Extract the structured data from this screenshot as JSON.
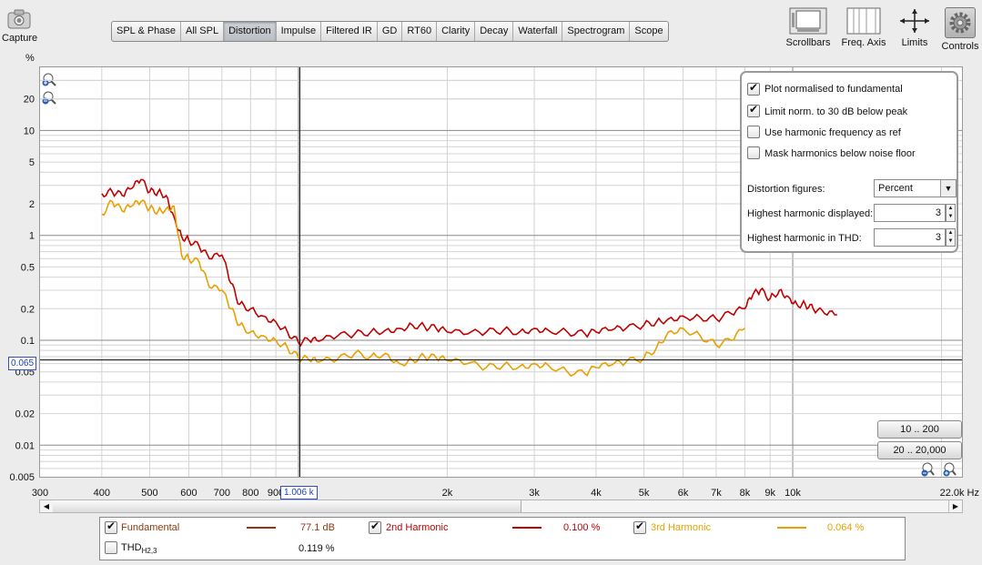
{
  "toolbar": {
    "capture_label": "Capture",
    "tabs": [
      "SPL & Phase",
      "All SPL",
      "Distortion",
      "Impulse",
      "Filtered IR",
      "GD",
      "RT60",
      "Clarity",
      "Decay",
      "Waterfall",
      "Spectrogram",
      "Scope"
    ],
    "active_tab": "Distortion",
    "right_buttons": [
      "Scrollbars",
      "Freq. Axis",
      "Limits",
      "Controls"
    ]
  },
  "plot": {
    "y_unit_label": "%",
    "cursor_y_readout": "0.065",
    "cursor_x_readout": "1.006 k"
  },
  "controls": {
    "checkboxes": [
      {
        "label": "Plot normalised to fundamental",
        "checked": true
      },
      {
        "label": "Limit norm. to 30 dB below peak",
        "checked": true
      },
      {
        "label": "Use harmonic frequency as ref",
        "checked": false
      },
      {
        "label": "Mask harmonics below noise floor",
        "checked": false
      }
    ],
    "distortion_figures_label": "Distortion figures:",
    "distortion_figures_value": "Percent",
    "highest_displayed_label": "Highest harmonic displayed:",
    "highest_displayed_value": "3",
    "highest_thd_label": "Highest harmonic in THD:",
    "highest_thd_value": "3"
  },
  "range_buttons": [
    "10 .. 200",
    "20 .. 20,000"
  ],
  "legend": {
    "fundamental": {
      "label": "Fundamental",
      "value": "77.1 dB",
      "checked": true,
      "color": "#8b3a0f"
    },
    "h2": {
      "label": "2nd Harmonic",
      "value": "0.100 %",
      "checked": true,
      "color": "#c00000"
    },
    "h3": {
      "label": "3rd Harmonic",
      "value": "0.064 %",
      "checked": true,
      "color": "#e8a000"
    },
    "thd": {
      "label": "THD",
      "sub": "H2,3",
      "value": "0.119 %",
      "checked": false
    }
  },
  "chart_data": {
    "type": "line",
    "xlabel": "Hz",
    "ylabel": "%",
    "x_scale": "log",
    "y_scale": "log",
    "xlim": [
      300,
      22000
    ],
    "ylim": [
      0.005,
      40
    ],
    "x_ticks": [
      {
        "v": 300,
        "l": "300"
      },
      {
        "v": 400,
        "l": "400"
      },
      {
        "v": 500,
        "l": "500"
      },
      {
        "v": 600,
        "l": "600"
      },
      {
        "v": 700,
        "l": "700"
      },
      {
        "v": 800,
        "l": "800"
      },
      {
        "v": 900,
        "l": "900"
      },
      {
        "v": 2000,
        "l": "2k"
      },
      {
        "v": 3000,
        "l": "3k"
      },
      {
        "v": 4000,
        "l": "4k"
      },
      {
        "v": 5000,
        "l": "5k"
      },
      {
        "v": 6000,
        "l": "6k"
      },
      {
        "v": 7000,
        "l": "7k"
      },
      {
        "v": 8000,
        "l": "8k"
      },
      {
        "v": 9000,
        "l": "9k"
      },
      {
        "v": 10000,
        "l": "10k"
      },
      {
        "v": 22000,
        "l": "22.0k Hz"
      }
    ],
    "y_ticks": [
      {
        "v": 20,
        "l": "20"
      },
      {
        "v": 10,
        "l": "10"
      },
      {
        "v": 5,
        "l": "5"
      },
      {
        "v": 2,
        "l": "2"
      },
      {
        "v": 1,
        "l": "1"
      },
      {
        "v": 0.5,
        "l": "0.5"
      },
      {
        "v": 0.2,
        "l": "0.2"
      },
      {
        "v": 0.1,
        "l": "0.1"
      },
      {
        "v": 0.05,
        "l": "0.05"
      },
      {
        "v": 0.02,
        "l": "0.02"
      },
      {
        "v": 0.01,
        "l": "0.01"
      },
      {
        "v": 0.005,
        "l": "0.005"
      }
    ],
    "cursor": {
      "x": 1006,
      "y": 0.065
    },
    "series": [
      {
        "name": "2nd Harmonic",
        "color": "#c00000",
        "x": [
          400,
          420,
          440,
          460,
          480,
          500,
          520,
          540,
          560,
          580,
          600,
          630,
          660,
          700,
          730,
          760,
          800,
          850,
          900,
          950,
          1000,
          1050,
          1100,
          1200,
          1300,
          1400,
          1500,
          1600,
          1700,
          1800,
          1900,
          2000,
          2200,
          2400,
          2600,
          2800,
          3000,
          3200,
          3500,
          3800,
          4000,
          4300,
          4600,
          5000,
          5300,
          5600,
          6000,
          6500,
          7000,
          7500,
          8000,
          8300,
          8600,
          9000,
          9400,
          9800,
          10200,
          10600,
          11000,
          11600,
          12300
        ],
        "y": [
          2.5,
          2.6,
          2.4,
          2.8,
          3.4,
          2.6,
          2.6,
          2.4,
          1.5,
          0.98,
          0.9,
          0.78,
          0.6,
          0.65,
          0.35,
          0.22,
          0.2,
          0.17,
          0.15,
          0.12,
          0.095,
          0.1,
          0.098,
          0.11,
          0.115,
          0.12,
          0.125,
          0.13,
          0.14,
          0.135,
          0.13,
          0.12,
          0.115,
          0.12,
          0.125,
          0.12,
          0.13,
          0.125,
          0.12,
          0.115,
          0.12,
          0.125,
          0.13,
          0.14,
          0.15,
          0.16,
          0.17,
          0.165,
          0.16,
          0.18,
          0.2,
          0.27,
          0.3,
          0.25,
          0.3,
          0.26,
          0.22,
          0.22,
          0.2,
          0.18,
          0.175
        ]
      },
      {
        "name": "3rd Harmonic",
        "color": "#e8a000",
        "x": [
          400,
          420,
          440,
          460,
          480,
          500,
          520,
          540,
          560,
          580,
          600,
          630,
          660,
          700,
          730,
          760,
          800,
          850,
          900,
          950,
          1000,
          1050,
          1100,
          1200,
          1300,
          1400,
          1500,
          1600,
          1700,
          1800,
          1900,
          2000,
          2200,
          2400,
          2600,
          2800,
          3000,
          3200,
          3500,
          3800,
          4000,
          4300,
          4600,
          5000,
          5300,
          5600,
          6000,
          6500,
          7000,
          7500,
          8000
        ],
        "y": [
          1.6,
          2.1,
          1.7,
          1.9,
          2.1,
          1.8,
          1.7,
          1.8,
          1.9,
          0.65,
          0.6,
          0.55,
          0.32,
          0.3,
          0.2,
          0.14,
          0.12,
          0.11,
          0.1,
          0.085,
          0.068,
          0.065,
          0.062,
          0.066,
          0.075,
          0.07,
          0.075,
          0.06,
          0.065,
          0.07,
          0.068,
          0.064,
          0.06,
          0.055,
          0.058,
          0.056,
          0.06,
          0.058,
          0.05,
          0.048,
          0.055,
          0.058,
          0.062,
          0.068,
          0.085,
          0.12,
          0.13,
          0.11,
          0.09,
          0.1,
          0.13
        ]
      }
    ]
  }
}
